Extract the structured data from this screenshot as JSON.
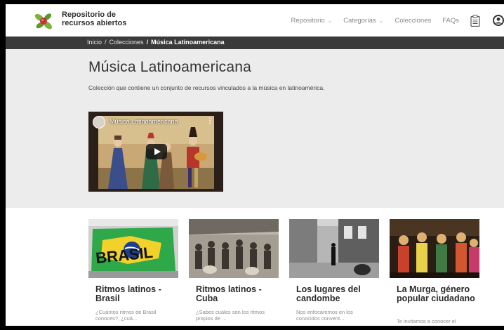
{
  "header": {
    "brand_line1": "Repositorio de",
    "brand_line2": "recursos abiertos",
    "nav": [
      {
        "label": "Repositorio",
        "dropdown": true
      },
      {
        "label": "Categorías",
        "dropdown": true
      },
      {
        "label": "Colecciones",
        "dropdown": false
      },
      {
        "label": "FAQs",
        "dropdown": false
      }
    ],
    "icons": [
      "clipboard-icon",
      "user-icon"
    ]
  },
  "breadcrumb": {
    "home": "Inicio",
    "sep": "/",
    "section": "Colecciones",
    "current": "Música Latinoamericana"
  },
  "page": {
    "title": "Música Latinoamericana",
    "description": "Colección que contiene un conjunto de recursos vinculados a la música en latinoamérica."
  },
  "video": {
    "title": "Música Latinoamericana",
    "menu": "⋮"
  },
  "cards": [
    {
      "title": "Ritmos latinos - Brasil",
      "desc": "¿Cuántos ritmos de Brasil conoces?, ¿cuá..."
    },
    {
      "title": "Ritmos latinos - Cuba",
      "desc": "¿Sabes cuáles son los ritmos propios de ..."
    },
    {
      "title": "Los lugares del candombe",
      "desc": "Nos enfocaremos en los conocidos convent..."
    },
    {
      "title": "La Murga, género popular ciudadano",
      "desc": "Te invitamos a conocer el"
    }
  ],
  "colors": {
    "crumb_bg": "#3a3a3a",
    "hero_bg": "#ececec",
    "logo_green": "#7fb13c",
    "logo_red": "#c8323a"
  }
}
